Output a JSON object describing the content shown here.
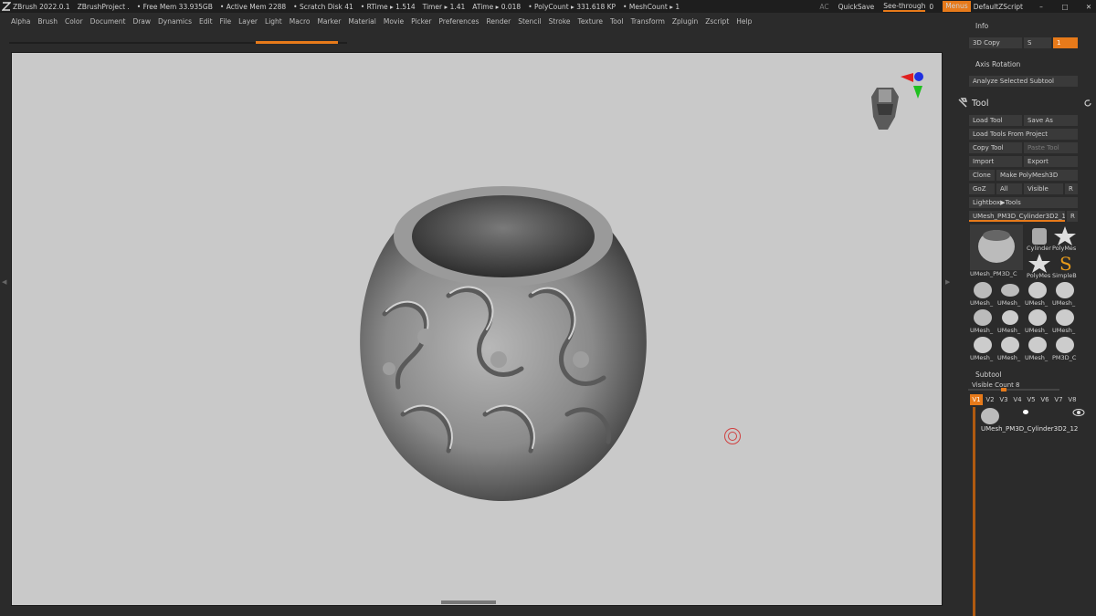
{
  "titlebar": {
    "app": "ZBrush 2022.0.1",
    "project": "ZBrushProject .",
    "free_mem": "• Free Mem 33.935GB",
    "active_mem": "• Active Mem 2288",
    "scratch": "• Scratch Disk 41",
    "rtime": "• RTime ▸ 1.514",
    "timer": "Timer ▸ 1.41",
    "atime": "ATime ▸ 0.018",
    "polycount": "• PolyCount ▸ 331.618 KP",
    "meshcount": "• MeshCount ▸ 1",
    "ac": "AC",
    "quicksave": "QuickSave",
    "seethrough": "See-through",
    "seethrough_value": "0",
    "menus": "Menus",
    "script": "DefaultZScript"
  },
  "menubar": [
    "Alpha",
    "Brush",
    "Color",
    "Document",
    "Draw",
    "Dynamics",
    "Edit",
    "File",
    "Layer",
    "Light",
    "Macro",
    "Marker",
    "Material",
    "Movie",
    "Picker",
    "Preferences",
    "Render",
    "Stencil",
    "Stroke",
    "Texture",
    "Tool",
    "Transform",
    "Zplugin",
    "Zscript",
    "Help"
  ],
  "progress": 0.25,
  "panel": {
    "info": "Info",
    "copy3d": "3D Copy",
    "copy3d_s": "S",
    "copy3d_value": "1",
    "axis_rotation": "Axis Rotation",
    "analyze": "Analyze Selected Subtool",
    "tool_title": "Tool",
    "buttons": {
      "load_tool": "Load Tool",
      "save_as": "Save As",
      "load_from_project": "Load Tools From Project",
      "copy_tool": "Copy Tool",
      "paste_tool": "Paste Tool",
      "import": "Import",
      "export": "Export",
      "clone": "Clone",
      "make_polymesh": "Make PolyMesh3D",
      "goz": "GoZ",
      "all": "All",
      "visible": "Visible",
      "r": "R",
      "lightbox_tools": "Lightbox▶Tools"
    },
    "current_tool": "UMesh_PM3D_Cylinder3D2_1",
    "current_tool_r": "R",
    "tool_thumbs": {
      "big": "UMesh_PM3D_C",
      "cylinder": "Cylinder",
      "polymesh": "PolyMes",
      "polymesh2": "PolyMes",
      "simple": "SimpleB",
      "grid_label": "UMesh_",
      "last_label": "PM3D_C"
    },
    "subtool": "Subtool",
    "visible_count_label": "Visible Count",
    "visible_count_value": "8",
    "visible_count_fraction": 0.375,
    "vtabs": [
      "V1",
      "V2",
      "V3",
      "V4",
      "V5",
      "V6",
      "V7",
      "V8"
    ],
    "subtool_item": "UMesh_PM3D_Cylinder3D2_12"
  },
  "colors": {
    "accent": "#e77a1a",
    "canvas_bg": "#c9c9c9",
    "panel_bg": "#2b2b2b"
  }
}
